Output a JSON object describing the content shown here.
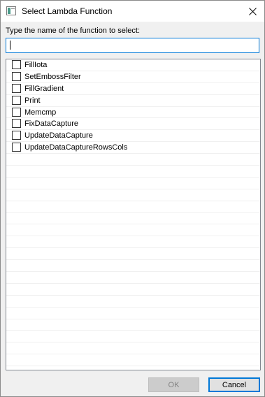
{
  "window": {
    "title": "Select Lambda Function",
    "icon": "window-app-icon",
    "close_icon": "close-icon"
  },
  "prompt": "Type the name of the function to select:",
  "search": {
    "value": "",
    "placeholder": ""
  },
  "functions": [
    {
      "label": "FillIota",
      "checked": false
    },
    {
      "label": "SetEmbossFilter",
      "checked": false
    },
    {
      "label": "FillGradient",
      "checked": false
    },
    {
      "label": "Print",
      "checked": false
    },
    {
      "label": "Memcmp",
      "checked": false
    },
    {
      "label": "FixDataCapture",
      "checked": false
    },
    {
      "label": "UpdateDataCapture",
      "checked": false
    },
    {
      "label": "UpdateDataCaptureRowsCols",
      "checked": false
    }
  ],
  "buttons": {
    "ok": {
      "label": "OK",
      "enabled": false
    },
    "cancel": {
      "label": "Cancel",
      "enabled": true
    }
  },
  "colors": {
    "accent": "#0078d7",
    "disabled_text": "#838383"
  }
}
